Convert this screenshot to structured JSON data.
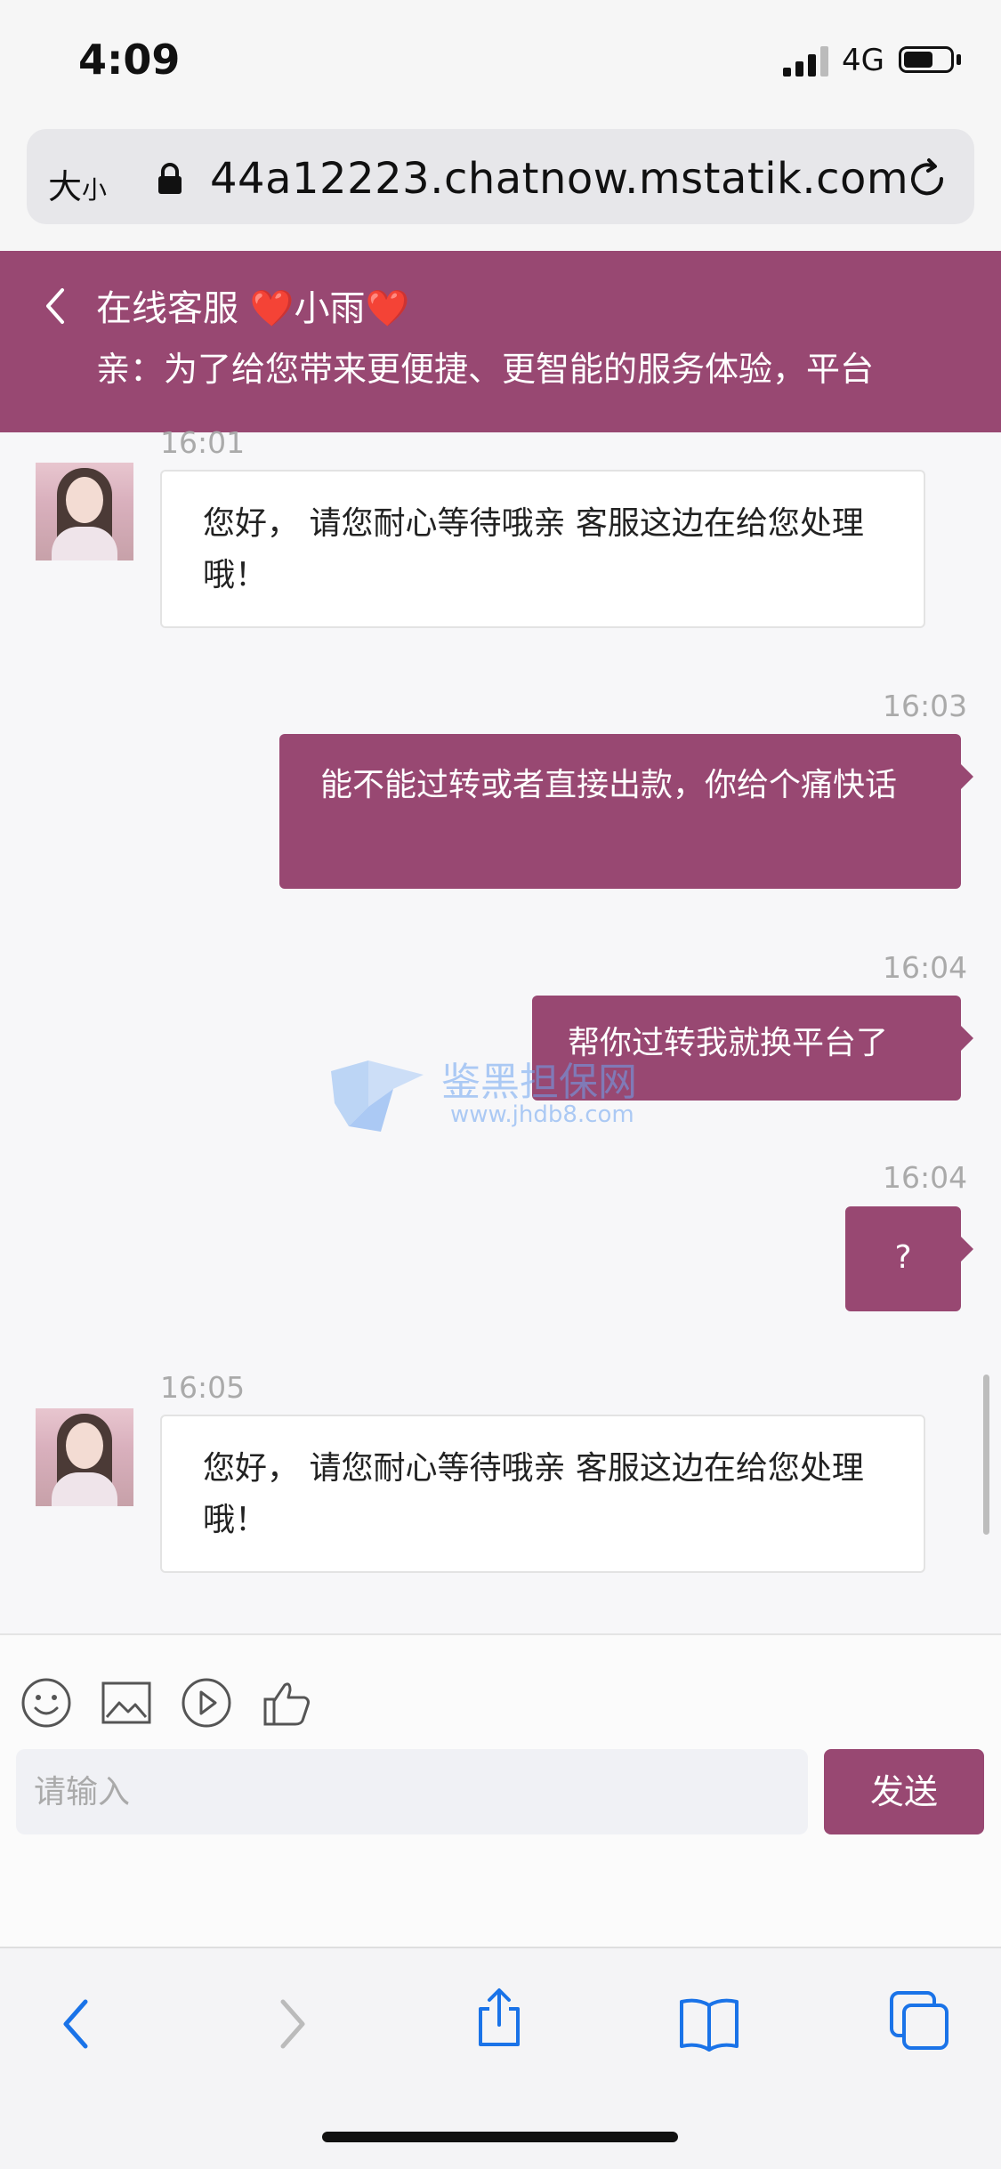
{
  "status_bar": {
    "time": "4:09",
    "network": "4G"
  },
  "browser": {
    "text_size_label": "大",
    "text_size_small": "小",
    "url": "44a12223.chatnow.mstatik.com"
  },
  "chat_header": {
    "title": "在线客服 ❤️小雨❤️",
    "notice": "亲：为了给您带来更便捷、更智能的服务体验，平台"
  },
  "messages": [
    {
      "direction": "in",
      "time": "16:01",
      "text": "您好， 请您耐心等待哦亲 客服这边在给您处理哦！"
    },
    {
      "direction": "out",
      "time": "16:03",
      "text": "能不能过转或者直接出款，你给个痛快话"
    },
    {
      "direction": "out",
      "time": "16:04",
      "text": "帮你过转我就换平台了"
    },
    {
      "direction": "out",
      "time": "16:04",
      "text": "?"
    },
    {
      "direction": "in",
      "time": "16:05",
      "text": "您好， 请您耐心等待哦亲 客服这边在给您处理哦！"
    }
  ],
  "watermark": {
    "text": "鉴黑担保网",
    "url": "www.jhdb8.com"
  },
  "composer": {
    "tools": [
      "emoji-icon",
      "image-icon",
      "video-icon",
      "thumbs-up-icon"
    ],
    "placeholder": "请输入",
    "send_label": "发送"
  },
  "safari_toolbar": {
    "icons": [
      "back-icon",
      "forward-icon",
      "share-icon",
      "bookmarks-icon",
      "tabs-icon"
    ],
    "accent_color": "#1a73e8"
  },
  "theme": {
    "primary": "#984872"
  }
}
